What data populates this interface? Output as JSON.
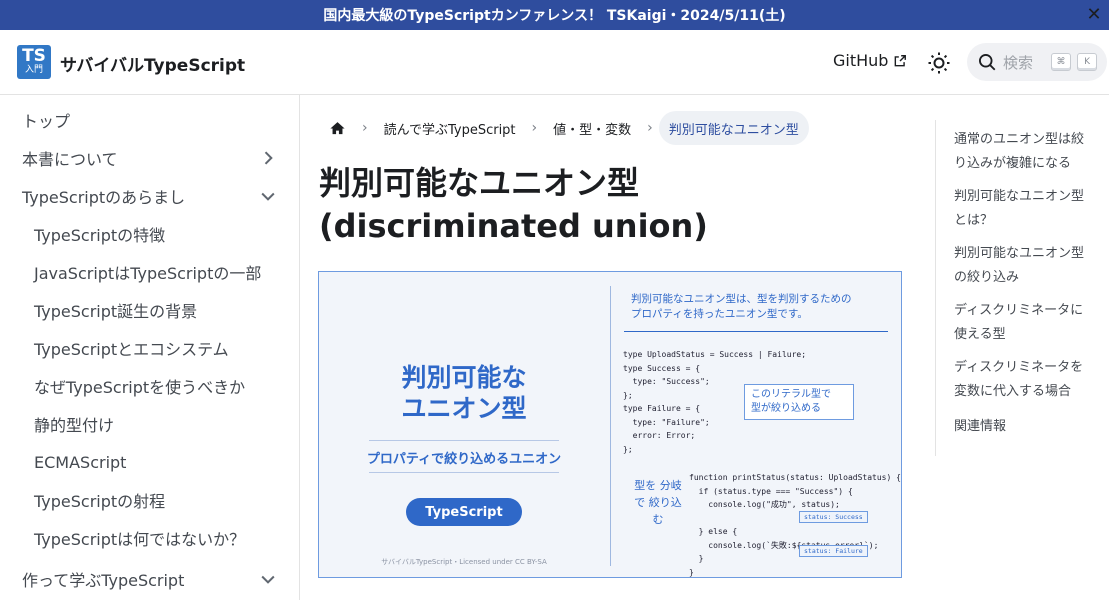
{
  "announcement": {
    "text": "国内最大級のTypeScriptカンファレンス！ TSKaigi・2024/5/11(土)",
    "close": "✕"
  },
  "navbar": {
    "logo_top": "TS",
    "logo_bottom": "入門",
    "brand": "サバイバルTypeScript",
    "github": "GitHub",
    "search_placeholder": "検索",
    "kbd_1": "⌘",
    "kbd_2": "K"
  },
  "sidebar": {
    "items": [
      {
        "label": "トップ"
      },
      {
        "label": "本書について"
      },
      {
        "label": "TypeScriptのあらまし"
      },
      {
        "label": "TypeScriptの特徴"
      },
      {
        "label": "JavaScriptはTypeScriptの一部"
      },
      {
        "label": "TypeScript誕生の背景"
      },
      {
        "label": "TypeScriptとエコシステム"
      },
      {
        "label": "なぜTypeScriptを使うべきか"
      },
      {
        "label": "静的型付け"
      },
      {
        "label": "ECMAScript"
      },
      {
        "label": "TypeScriptの射程"
      },
      {
        "label": "TypeScriptは何ではないか？"
      },
      {
        "label": "作って学ぶTypeScript"
      }
    ]
  },
  "breadcrumb": {
    "items": [
      "読んで学ぶTypeScript",
      "値・型・変数"
    ],
    "current": "判別可能なユニオン型",
    "separator": "›"
  },
  "page": {
    "title_line1": "判別可能なユニオン型",
    "title_line2": "(discriminated union)"
  },
  "figure": {
    "title_line1": "判別可能な",
    "title_line2": "ユニオン型",
    "subtitle": "プロパティで絞り込めるユニオン",
    "pill": "TypeScript",
    "license": "サバイバルTypeScript・Licensed under CC BY-SA",
    "desc_line1": "判別可能なユニオン型は、型を判別するための",
    "desc_line2": "プロパティを持ったユニオン型です。",
    "code1": "type UploadStatus = Success | Failure;\ntype Success = {\n  type: \"Success\";\n};\ntype Failure = {\n  type: \"Failure\";\n  error: Error;\n};",
    "note1_line1": "このリテラル型で",
    "note1_line2": "型が絞り込める",
    "note2": "型を 分岐で 絞り込む",
    "code2": "function printStatus(status: UploadStatus) {\n  if (status.type === \"Success\") {\n    console.log(\"成功\", status);\n\n  } else {\n    console.log(`失敗:${status.error}`);\n  }\n}",
    "tag1": "status: Success",
    "tag2": "status: Failure"
  },
  "toc": {
    "items": [
      {
        "line1": "通常のユニオン型は絞",
        "line2": "り込みが複雑になる"
      },
      {
        "line1": "判別可能なユニオン型",
        "line2": "とは？"
      },
      {
        "line1": "判別可能なユニオン型",
        "line2": "の絞り込み"
      },
      {
        "line1": "ディスクリミネータに",
        "line2": "使える型"
      },
      {
        "line1": "ディスクリミネータを",
        "line2": "変数に代入する場合"
      },
      {
        "line1": "関連情報",
        "line2": ""
      }
    ]
  }
}
